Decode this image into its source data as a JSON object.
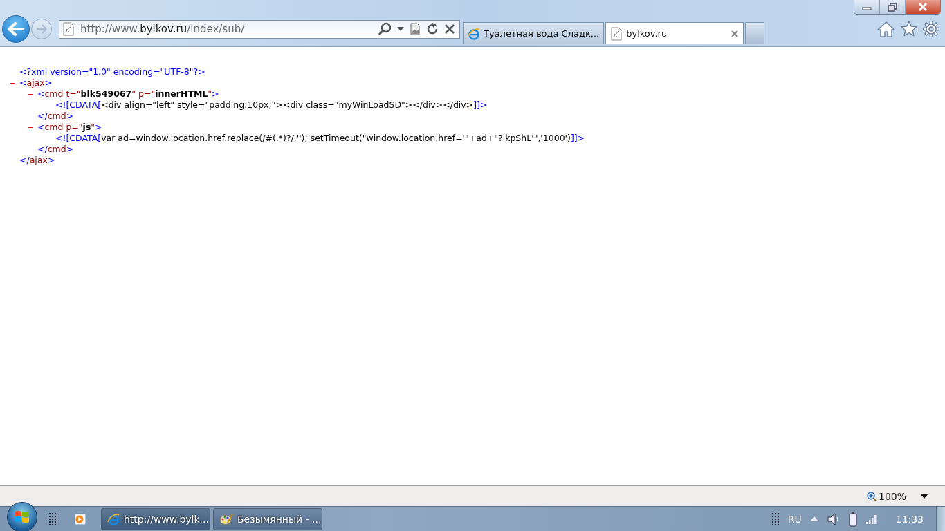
{
  "address_bar": {
    "url_prefix": "http://www.",
    "url_domain": "bylkov.ru",
    "url_path": "/index/sub/"
  },
  "tabs": [
    {
      "label": "Туалетная вода Сладк...",
      "selected": false,
      "kind": "browser"
    },
    {
      "label": "bylkov.ru",
      "selected": true,
      "kind": "page"
    }
  ],
  "document": [
    {
      "kind": "leaf",
      "tokens": [
        {
          "kind": "markup",
          "text": "<?xml version=\"1.0\" encoding=\"UTF-8\"?>"
        }
      ]
    },
    {
      "kind": "element",
      "expanded": true,
      "open": [
        {
          "kind": "markup",
          "text": "<"
        },
        {
          "kind": "name",
          "text": "ajax"
        },
        {
          "kind": "markup",
          "text": ">"
        }
      ],
      "children": [
        {
          "kind": "element",
          "expanded": true,
          "open": [
            {
              "kind": "markup",
              "text": "<"
            },
            {
              "kind": "name",
              "text": "cmd t=\""
            },
            {
              "kind": "value",
              "text": "blk549067"
            },
            {
              "kind": "name",
              "text": "\" p=\""
            },
            {
              "kind": "value",
              "text": "innerHTML"
            },
            {
              "kind": "name",
              "text": "\""
            },
            {
              "kind": "markup",
              "text": ">"
            }
          ],
          "children": [
            {
              "kind": "leaf",
              "tokens": [
                {
                  "kind": "markup",
                  "text": "<![CDATA["
                },
                {
                  "kind": "text",
                  "text": "<div align=\"left\" style=\"padding:10px;\"><div class=\"myWinLoadSD\"></div></div>"
                },
                {
                  "kind": "markup",
                  "text": "]]>"
                }
              ]
            }
          ],
          "close": [
            {
              "kind": "markup",
              "text": "</"
            },
            {
              "kind": "name",
              "text": "cmd"
            },
            {
              "kind": "markup",
              "text": ">"
            }
          ]
        },
        {
          "kind": "element",
          "expanded": true,
          "open": [
            {
              "kind": "markup",
              "text": "<"
            },
            {
              "kind": "name",
              "text": "cmd p=\""
            },
            {
              "kind": "value",
              "text": "js"
            },
            {
              "kind": "name",
              "text": "\""
            },
            {
              "kind": "markup",
              "text": ">"
            }
          ],
          "children": [
            {
              "kind": "leaf",
              "tokens": [
                {
                  "kind": "markup",
                  "text": "<![CDATA["
                },
                {
                  "kind": "text",
                  "text": "var ad=window.location.href.replace(/#(.*)?/,''); setTimeout(\"window.location.href='\"+ad+\"?lkpShL'\",'1000')"
                },
                {
                  "kind": "markup",
                  "text": "]]>"
                }
              ]
            }
          ],
          "close": [
            {
              "kind": "markup",
              "text": "</"
            },
            {
              "kind": "name",
              "text": "cmd"
            },
            {
              "kind": "markup",
              "text": ">"
            }
          ]
        }
      ],
      "close": [
        {
          "kind": "markup",
          "text": "</"
        },
        {
          "kind": "name",
          "text": "ajax"
        },
        {
          "kind": "markup",
          "text": ">"
        }
      ]
    }
  ],
  "status_bar": {
    "zoom": "100%"
  },
  "taskbar": {
    "items": [
      {
        "label": "http://www.bylk...",
        "kind": "browser",
        "selected": true
      },
      {
        "label": "Безымянный - ...",
        "kind": "palette",
        "selected": false
      }
    ],
    "language": "RU",
    "clock": "11:33"
  }
}
